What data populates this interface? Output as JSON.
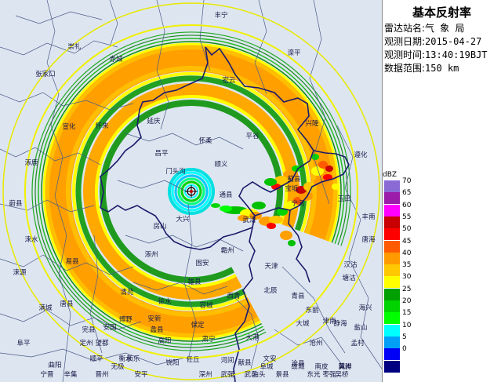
{
  "panel": {
    "title": "基本反射率",
    "station_label": "雷达站名:",
    "station_value": "气 象 局",
    "date_label": "观测日期:",
    "date_value": "2015-04-27",
    "time_label": "观测时间:",
    "time_value": "13:40:19BJT",
    "range_label": "数据范围:",
    "range_value": "150 km"
  },
  "legend": {
    "title": "dBZ",
    "items": [
      {
        "label": "70",
        "color": "#8a6bd6"
      },
      {
        "label": "65",
        "color": "#9b1ca8"
      },
      {
        "label": "60",
        "color": "#ff00ff"
      },
      {
        "label": "55",
        "color": "#c80000"
      },
      {
        "label": "50",
        "color": "#ff0000"
      },
      {
        "label": "45",
        "color": "#ff5a00"
      },
      {
        "label": "40",
        "color": "#ff9b00"
      },
      {
        "label": "35",
        "color": "#ffc800"
      },
      {
        "label": "30",
        "color": "#ffff00"
      },
      {
        "label": "25",
        "color": "#00a000"
      },
      {
        "label": "20",
        "color": "#00d400"
      },
      {
        "label": "15",
        "color": "#00ff00"
      },
      {
        "label": "10",
        "color": "#00ffff"
      },
      {
        "label": "5",
        "color": "#00a0f6"
      },
      {
        "label": "0",
        "color": "#0000f6"
      },
      {
        "label": "",
        "color": "#000080"
      }
    ]
  },
  "map": {
    "place_names": [
      {
        "t": "丰宁"
      },
      {
        "t": "崇礼"
      },
      {
        "t": "张家口"
      },
      {
        "t": "赤城"
      },
      {
        "t": "滦平"
      },
      {
        "t": "宣化"
      },
      {
        "t": "怀来"
      },
      {
        "t": "延庆"
      },
      {
        "t": "密云"
      },
      {
        "t": "兴隆"
      },
      {
        "t": "遵化"
      },
      {
        "t": "涿鹿"
      },
      {
        "t": "昌平"
      },
      {
        "t": "怀柔"
      },
      {
        "t": "顺义"
      },
      {
        "t": "平谷"
      },
      {
        "t": "蓟县"
      },
      {
        "t": "蔚县"
      },
      {
        "t": "门头沟"
      },
      {
        "t": "通县"
      },
      {
        "t": "玉田"
      },
      {
        "t": "房山"
      },
      {
        "t": "大兴"
      },
      {
        "t": "涞水"
      },
      {
        "t": "涿州"
      },
      {
        "t": "固安"
      },
      {
        "t": "易县"
      },
      {
        "t": "宝坻"
      },
      {
        "t": "丰南"
      },
      {
        "t": "唐海"
      },
      {
        "t": "宁河"
      },
      {
        "t": "武清"
      },
      {
        "t": "霸州"
      },
      {
        "t": "雄县"
      },
      {
        "t": "天津"
      },
      {
        "t": "北辰"
      },
      {
        "t": "西青"
      },
      {
        "t": "东丽"
      },
      {
        "t": "津南"
      },
      {
        "t": "大港"
      },
      {
        "t": "塘沽"
      },
      {
        "t": "汉沽"
      },
      {
        "t": "唐县"
      },
      {
        "t": "满城"
      },
      {
        "t": "清苑"
      },
      {
        "t": "徐水"
      },
      {
        "t": "容城"
      },
      {
        "t": "安新"
      },
      {
        "t": "保定"
      },
      {
        "t": "高阳"
      },
      {
        "t": "任丘"
      },
      {
        "t": "河间"
      },
      {
        "t": "文安"
      },
      {
        "t": "大城"
      },
      {
        "t": "静海"
      },
      {
        "t": "青县"
      },
      {
        "t": "黄骅"
      },
      {
        "t": "完县"
      },
      {
        "t": "望都"
      },
      {
        "t": "涞源"
      },
      {
        "t": "阜平"
      },
      {
        "t": "曲阳"
      },
      {
        "t": "顺平"
      },
      {
        "t": "蠡县"
      },
      {
        "t": "肃宁"
      },
      {
        "t": "献县"
      },
      {
        "t": "沧州"
      },
      {
        "t": "沧县"
      },
      {
        "t": "泊头"
      },
      {
        "t": "南皮"
      },
      {
        "t": "孟村"
      },
      {
        "t": "盐山"
      },
      {
        "t": "海兴"
      },
      {
        "t": "东光"
      },
      {
        "t": "吴桥"
      },
      {
        "t": "安平"
      },
      {
        "t": "饶阳"
      },
      {
        "t": "深州"
      },
      {
        "t": "武强"
      },
      {
        "t": "武邑"
      },
      {
        "t": "阜城"
      },
      {
        "t": "景县"
      },
      {
        "t": "故城"
      },
      {
        "t": "枣强"
      },
      {
        "t": "冀州"
      },
      {
        "t": "衡水"
      },
      {
        "t": "宁晋"
      },
      {
        "t": "辛集"
      },
      {
        "t": "晋州"
      },
      {
        "t": "无极"
      },
      {
        "t": "新乐"
      },
      {
        "t": "定州"
      },
      {
        "t": "安国"
      },
      {
        "t": "博野"
      }
    ]
  }
}
